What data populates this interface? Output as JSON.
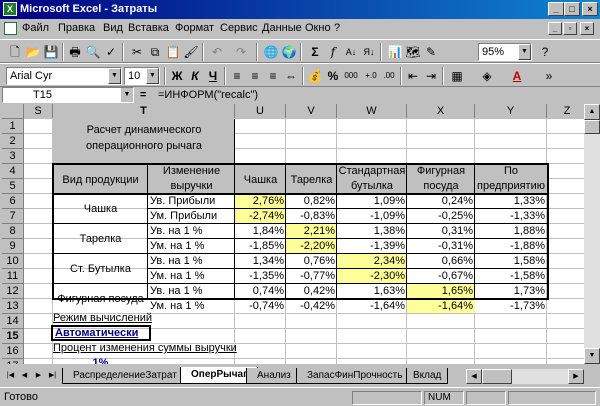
{
  "window": {
    "title": "Microsoft Excel - Затраты",
    "app_icon": "X"
  },
  "menu": [
    "Файл",
    "Правка",
    "Вид",
    "Вставка",
    "Формат",
    "Сервис",
    "Данные",
    "Окно",
    "?"
  ],
  "toolbar": {
    "zoom": "95%",
    "font": "Arial Cyr",
    "size": "10",
    "bold": "Ж",
    "italic": "К",
    "underline": "Ч",
    "percent": "%",
    "comma": "000"
  },
  "formula_bar": {
    "name_box": "T15",
    "equals": "=",
    "formula": "=ИНФОРМ(\"recalc\")"
  },
  "columns": [
    "S",
    "T",
    "U",
    "V",
    "W",
    "X",
    "Y",
    "Z",
    "A"
  ],
  "rows": [
    "1",
    "2",
    "3",
    "4",
    "5",
    "6",
    "7",
    "8",
    "9",
    "10",
    "11",
    "12",
    "13",
    "14",
    "15",
    "16",
    "17"
  ],
  "table": {
    "title": "Расчет динамического операционного рычага",
    "title_line1": "Расчет динамического",
    "title_line2": "операционного рычага",
    "headers": {
      "product": "Вид продукции",
      "change_1": "Изменение",
      "change_2": "выручки",
      "cup": "Чашка",
      "plate": "Тарелка",
      "bottle_1": "Стандартная",
      "bottle_2": "бутылка",
      "fig_1": "Фигурная",
      "fig_2": "посуда",
      "total_1": "По",
      "total_2": "предприятию"
    },
    "groups": [
      {
        "name": "Чашка",
        "rows": [
          {
            "change": "Ув. Прибыли",
            "values": [
              "2,76%",
              "0,82%",
              "1,09%",
              "0,24%",
              "1,33%"
            ]
          },
          {
            "change": "Ум. Прибыли",
            "values": [
              "-2,74%",
              "-0,83%",
              "-1,09%",
              "-0,25%",
              "-1,33%"
            ]
          }
        ],
        "highlight_col": 0
      },
      {
        "name": "Тарелка",
        "rows": [
          {
            "change": "Ув. на 1 %",
            "values": [
              "1,84%",
              "2,21%",
              "1,38%",
              "0,31%",
              "1,88%"
            ]
          },
          {
            "change": "Ум. на 1 %",
            "values": [
              "-1,85%",
              "-2,20%",
              "-1,39%",
              "-0,31%",
              "-1,88%"
            ]
          }
        ],
        "highlight_col": 1
      },
      {
        "name": "Ст. Бутылка",
        "rows": [
          {
            "change": "Ув. на 1 %",
            "values": [
              "1,34%",
              "0,76%",
              "2,34%",
              "0,66%",
              "1,58%"
            ]
          },
          {
            "change": "Ум. на 1 %",
            "values": [
              "-1,35%",
              "-0,77%",
              "-2,30%",
              "-0,67%",
              "-1,58%"
            ]
          }
        ],
        "highlight_col": 2
      },
      {
        "name": "Фигурная посуда",
        "rows": [
          {
            "change": "Ув. на 1 %",
            "values": [
              "0,74%",
              "0,42%",
              "1,63%",
              "1,65%",
              "1,73%"
            ]
          },
          {
            "change": "Ум. на 1 %",
            "values": [
              "-0,74%",
              "-0,42%",
              "-1,64%",
              "-1,64%",
              "-1,73%"
            ]
          }
        ],
        "highlight_col": 3
      }
    ]
  },
  "calc_mode_label": "Режим вычислений",
  "calc_mode_value": "Автоматически",
  "pct_label": "Процент изменения суммы выручки",
  "pct_value": "1%",
  "sheet_tabs": [
    "РаспределениеЗатрат",
    "ОперРычаг",
    "Анализ",
    "ЗапасФинПрочность",
    "Вклад"
  ],
  "active_tab": "ОперРычаг",
  "status": {
    "ready": "Готово",
    "num": "NUM"
  },
  "colors": {
    "highlight": "#ffff99",
    "title_bg": "#000080",
    "link_text": "#000080"
  }
}
